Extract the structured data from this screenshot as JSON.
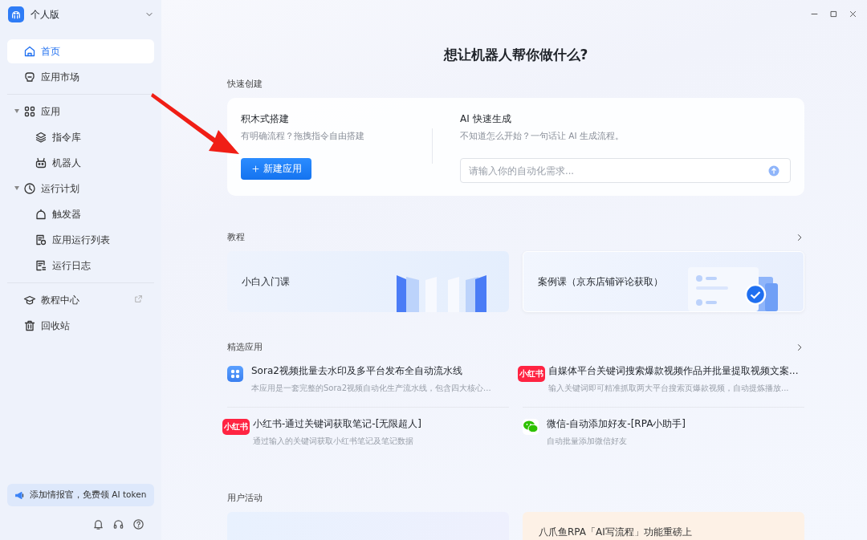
{
  "sidebar": {
    "edition": "个人版",
    "sections": [
      [
        {
          "label": "首页",
          "kind": "home",
          "selected": true
        },
        {
          "label": "应用市场",
          "kind": "market",
          "selected": false
        }
      ],
      [
        {
          "label": "应用",
          "kind": "apps",
          "selected": false,
          "expanded": true,
          "children": [
            {
              "label": "指令库",
              "kind": "layers",
              "selected": false
            },
            {
              "label": "机器人",
              "kind": "robot",
              "selected": false
            }
          ]
        },
        {
          "label": "运行计划",
          "kind": "clock",
          "selected": false,
          "expanded": true,
          "children": [
            {
              "label": "触发器",
              "kind": "trigger",
              "selected": false
            },
            {
              "label": "应用运行列表",
              "kind": "list",
              "selected": false
            },
            {
              "label": "运行日志",
              "kind": "log",
              "selected": false
            }
          ]
        }
      ],
      [
        {
          "label": "教程中心",
          "kind": "cap",
          "selected": false,
          "external": true
        },
        {
          "label": "回收站",
          "kind": "trash",
          "selected": false
        }
      ]
    ],
    "promo": "添加情报官，免费领 AI token"
  },
  "main": {
    "heading": "想让机器人帮你做什么?",
    "quick_create": {
      "label": "快速创建",
      "blocks": {
        "title": "积木式搭建",
        "desc": "有明确流程？拖拽指令自由搭建",
        "button": "新建应用"
      },
      "ai": {
        "title": "AI 快速生成",
        "desc": "不知道怎么开始？一句话让 AI 生成流程。",
        "placeholder": "请输入你的自动化需求..."
      }
    },
    "tutorials": {
      "label": "教程",
      "cards": [
        {
          "title": "小白入门课",
          "kind": "books"
        },
        {
          "title": "案例课（京东店铺评论获取）",
          "kind": "checklist"
        }
      ]
    },
    "featured": {
      "label": "精选应用",
      "apps": [
        {
          "title": "Sora2视频批量去水印及多平台发布全自动流水线",
          "desc": "本应用是一套完整的Sora2视频自动化生产流水线，包含四大核心...",
          "kind": "grid"
        },
        {
          "title": "自媒体平台关键词搜索爆款视频作品并批量提取视频文案...",
          "desc": "输入关键词即可精准抓取两大平台搜索页爆款视频，自动提炼播放...",
          "kind": "badge",
          "icon_text": "小红书"
        },
        {
          "title": "小红书-通过关键词获取笔记-[无限超人]",
          "desc": "通过输入的关键词获取小红书笔记及笔记数据",
          "kind": "badge",
          "icon_text": "小红书"
        },
        {
          "title": "微信-自动添加好友-[RPA小助手]",
          "desc": "自动批量添加微信好友",
          "kind": "chat"
        }
      ]
    },
    "activity": {
      "label": "用户活动",
      "cards": [
        {
          "kind": "plain"
        },
        {
          "kind": "promo",
          "title": "八爪鱼RPA「AI写流程」功能重磅上"
        }
      ]
    }
  }
}
